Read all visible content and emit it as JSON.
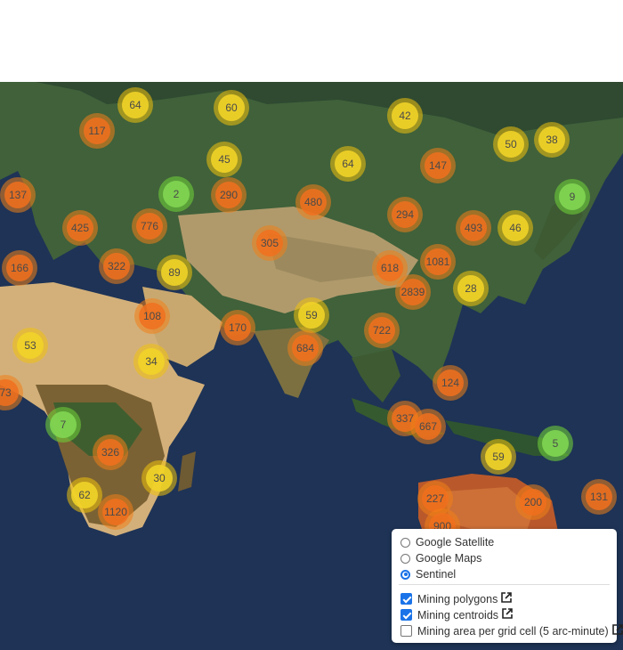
{
  "map": {
    "clusters": [
      {
        "label": "64",
        "color": "yellow"
      },
      {
        "label": "60",
        "color": "yellow"
      },
      {
        "label": "42",
        "color": "yellow"
      },
      {
        "label": "117",
        "color": "orange"
      },
      {
        "label": "50",
        "color": "yellow"
      },
      {
        "label": "38",
        "color": "yellow"
      },
      {
        "label": "45",
        "color": "yellow"
      },
      {
        "label": "64",
        "color": "yellow"
      },
      {
        "label": "147",
        "color": "orange"
      },
      {
        "label": "137",
        "color": "orange"
      },
      {
        "label": "2",
        "color": "green"
      },
      {
        "label": "290",
        "color": "orange"
      },
      {
        "label": "480",
        "color": "orange"
      },
      {
        "label": "9",
        "color": "green"
      },
      {
        "label": "425",
        "color": "orange"
      },
      {
        "label": "776",
        "color": "orange"
      },
      {
        "label": "294",
        "color": "orange"
      },
      {
        "label": "493",
        "color": "orange"
      },
      {
        "label": "46",
        "color": "yellow"
      },
      {
        "label": "305",
        "color": "orange"
      },
      {
        "label": "166",
        "color": "orange"
      },
      {
        "label": "322",
        "color": "orange"
      },
      {
        "label": "89",
        "color": "yellow"
      },
      {
        "label": "618",
        "color": "orange"
      },
      {
        "label": "1081",
        "color": "orange"
      },
      {
        "label": "2839",
        "color": "orange"
      },
      {
        "label": "28",
        "color": "yellow"
      },
      {
        "label": "108",
        "color": "orange"
      },
      {
        "label": "59",
        "color": "yellow"
      },
      {
        "label": "170",
        "color": "orange"
      },
      {
        "label": "722",
        "color": "orange"
      },
      {
        "label": "53",
        "color": "yellow"
      },
      {
        "label": "684",
        "color": "orange"
      },
      {
        "label": "34",
        "color": "yellow"
      },
      {
        "label": "73",
        "color": "orange"
      },
      {
        "label": "124",
        "color": "orange"
      },
      {
        "label": "337",
        "color": "orange"
      },
      {
        "label": "667",
        "color": "orange"
      },
      {
        "label": "7",
        "color": "green"
      },
      {
        "label": "5",
        "color": "green"
      },
      {
        "label": "326",
        "color": "orange"
      },
      {
        "label": "59",
        "color": "yellow"
      },
      {
        "label": "30",
        "color": "yellow"
      },
      {
        "label": "62",
        "color": "yellow"
      },
      {
        "label": "227",
        "color": "orange"
      },
      {
        "label": "200",
        "color": "orange"
      },
      {
        "label": "131",
        "color": "orange"
      },
      {
        "label": "1120",
        "color": "orange"
      },
      {
        "label": "900",
        "color": "orange"
      }
    ]
  },
  "layers": {
    "base_layers": [
      {
        "label": "Google Satellite",
        "selected": false
      },
      {
        "label": "Google Maps",
        "selected": false
      },
      {
        "label": "Sentinel",
        "selected": true
      }
    ],
    "overlays": [
      {
        "label": "Mining polygons",
        "checked": true,
        "link_icon": "external-link-icon"
      },
      {
        "label": "Mining centroids",
        "checked": true,
        "link_icon": "external-link-icon"
      },
      {
        "label": "Mining area per grid cell (5 arc-minute)",
        "checked": false,
        "link_icon": "external-link-icon"
      }
    ]
  },
  "colors": {
    "ocean": "#1e3356",
    "cluster_orange": "#f0701e",
    "cluster_yellow": "#f1d328",
    "cluster_green": "#81d652",
    "accent": "#1a73e8"
  }
}
